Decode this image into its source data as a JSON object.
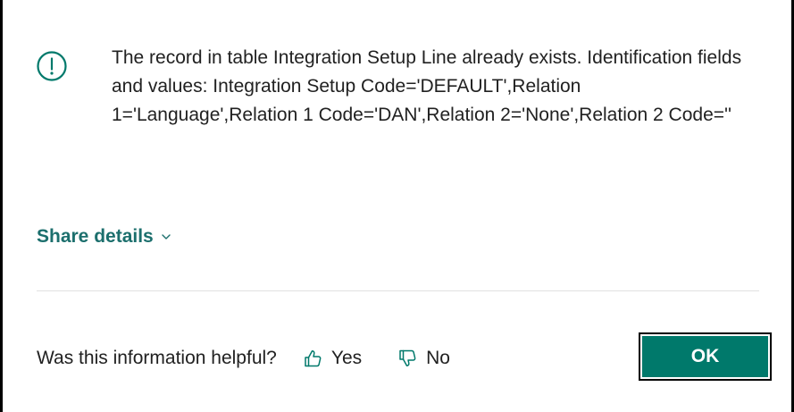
{
  "dialog": {
    "icon": "exclamation-circle-icon",
    "accent_color": "#00796b",
    "link_color": "#1c6f6d",
    "message": "The record in table Integration Setup Line already exists. Identification fields and values: Integration Setup Code='DEFAULT',Relation 1='Language',Relation 1 Code='DAN',Relation 2='None',Relation 2 Code=''",
    "share_details_label": "Share details",
    "share_details_icon": "chevron-down-icon"
  },
  "feedback": {
    "question": "Was this information helpful?",
    "yes_label": "Yes",
    "yes_icon": "thumbs-up-icon",
    "no_label": "No",
    "no_icon": "thumbs-down-icon"
  },
  "actions": {
    "ok_label": "OK"
  }
}
